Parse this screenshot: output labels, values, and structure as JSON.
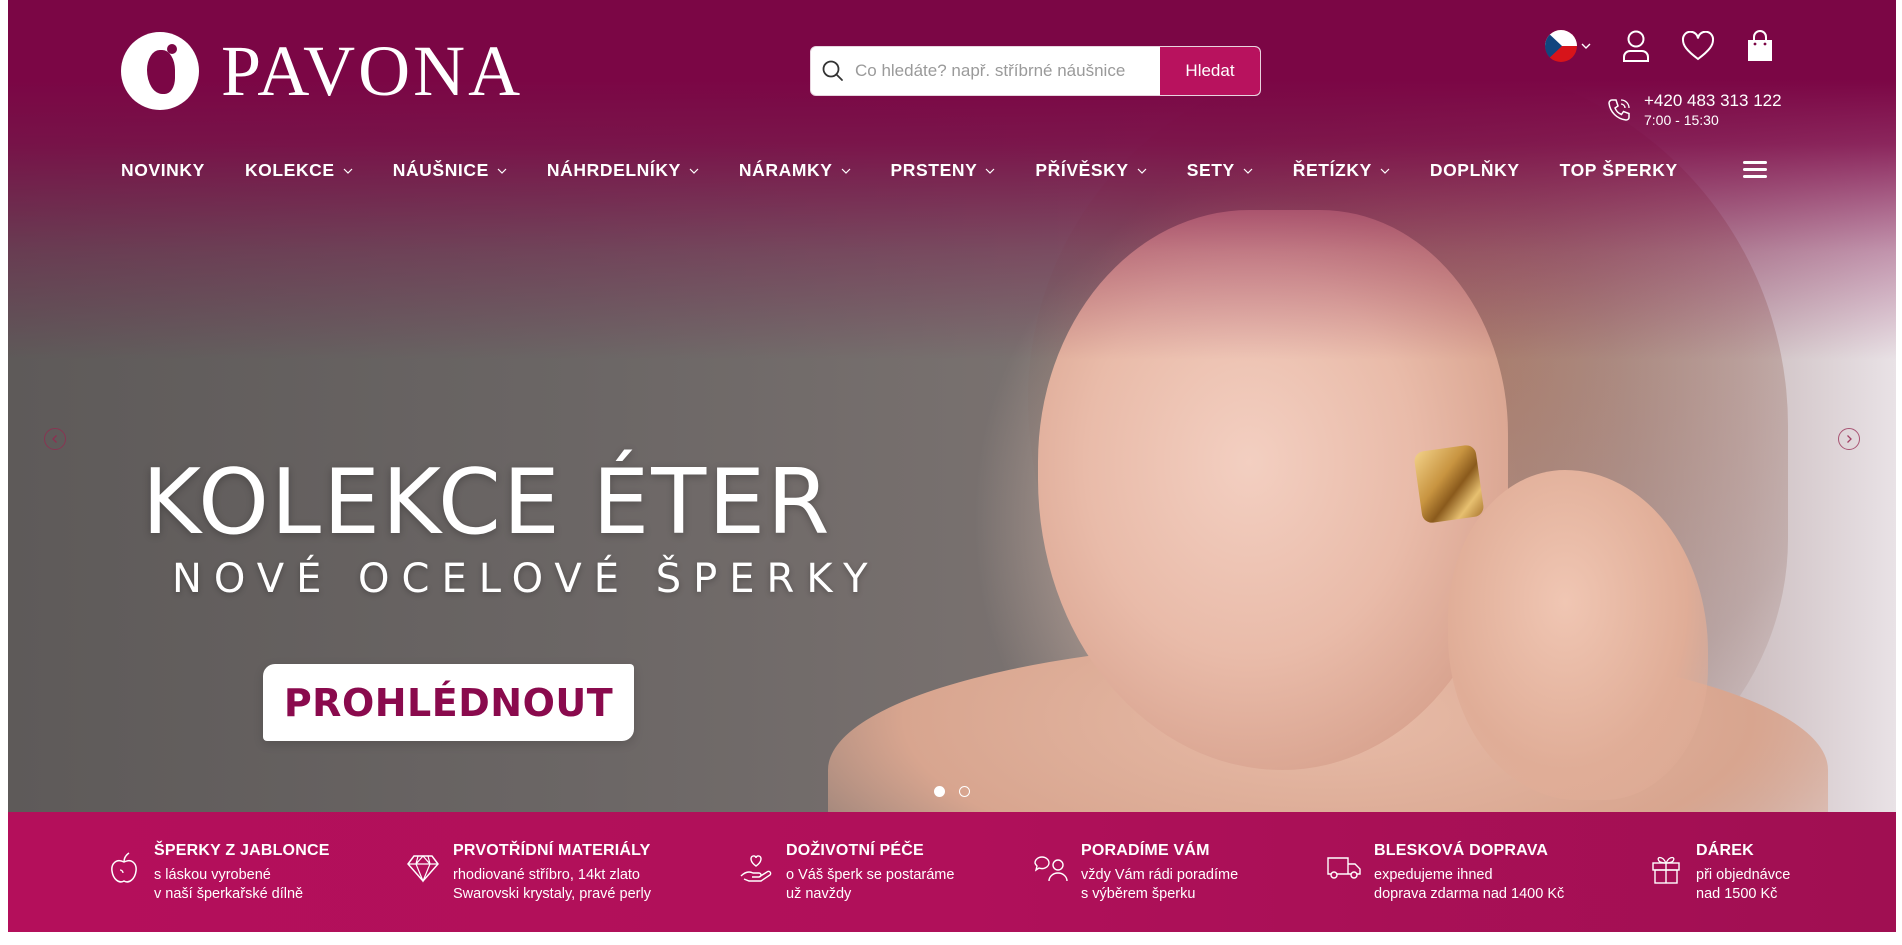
{
  "header": {
    "brand_name": "PAVONA",
    "search": {
      "placeholder": "Co hledáte? např. stříbrné náušnice",
      "value": "",
      "button_label": "Hledat"
    },
    "language": "cs",
    "phone": {
      "number": "+420 483 313 122",
      "hours": "7:00 - 15:30"
    }
  },
  "nav": {
    "items": [
      {
        "label": "NOVINKY",
        "has_dropdown": false
      },
      {
        "label": "KOLEKCE",
        "has_dropdown": true
      },
      {
        "label": "NÁUŠNICE",
        "has_dropdown": true
      },
      {
        "label": "NÁHRDELNÍKY",
        "has_dropdown": true
      },
      {
        "label": "NÁRAMKY",
        "has_dropdown": true
      },
      {
        "label": "PRSTENY",
        "has_dropdown": true
      },
      {
        "label": "PŘÍVĚSKY",
        "has_dropdown": true
      },
      {
        "label": "SETY",
        "has_dropdown": true
      },
      {
        "label": "ŘETÍZKY",
        "has_dropdown": true
      },
      {
        "label": "DOPLŇKY",
        "has_dropdown": false
      },
      {
        "label": "TOP ŠPERKY",
        "has_dropdown": false
      }
    ]
  },
  "hero": {
    "title": "KOLEKCE ÉTER",
    "subtitle": "NOVÉ OCELOVÉ ŠPERKY",
    "cta_label": "PROHLÉDNOUT",
    "active_slide": 1,
    "slide_count": 2
  },
  "benefits": [
    {
      "icon": "apple-icon",
      "title": "ŠPERKY Z JABLONCE",
      "line1": "s láskou vyrobené",
      "line2": "v naší šperkařské dílně"
    },
    {
      "icon": "diamond-icon",
      "title": "PRVOTŘÍDNÍ MATERIÁLY",
      "line1": "rhodiované stříbro, 14kt zlato",
      "line2": "Swarovski krystaly, pravé perly"
    },
    {
      "icon": "hand-heart-icon",
      "title": "DOŽIVOTNÍ PÉČE",
      "line1": "o Váš šperk se postaráme",
      "line2": "už navždy"
    },
    {
      "icon": "chat-person-icon",
      "title": "PORADÍME VÁM",
      "line1": "vždy Vám rádi poradíme",
      "line2": "s výběrem šperku"
    },
    {
      "icon": "truck-icon",
      "title": "BLESKOVÁ DOPRAVA",
      "line1": "expedujeme ihned",
      "line2": "doprava zdarma nad 1400 Kč"
    },
    {
      "icon": "gift-icon",
      "title": "DÁREK",
      "line1": "při objednávce",
      "line2": "nad 1500 Kč"
    }
  ],
  "colors": {
    "brand_dark": "#7b0645",
    "brand_accent": "#b8125e",
    "benefits_bg": "#b0105a",
    "cta_text": "#8a0a4d"
  }
}
